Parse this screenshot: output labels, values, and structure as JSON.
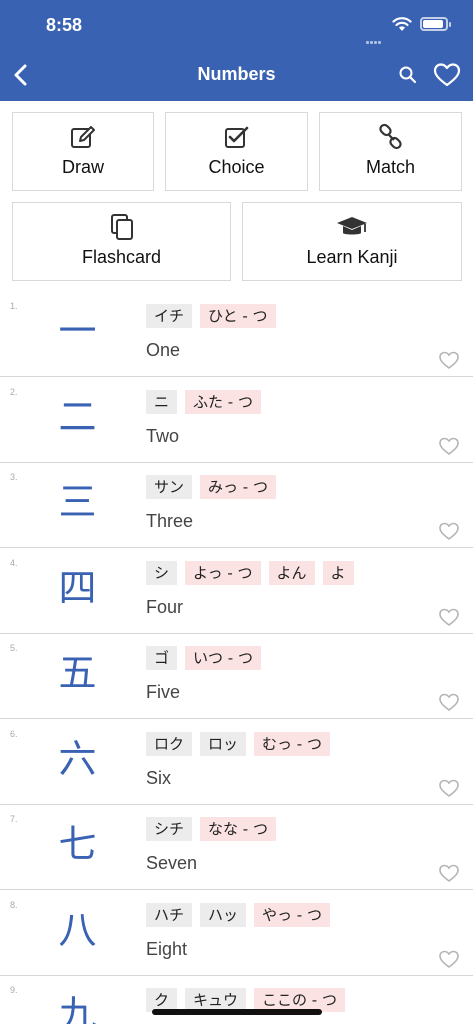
{
  "status_bar": {
    "time": "8:58"
  },
  "nav": {
    "title": "Numbers"
  },
  "modes": [
    {
      "label": "Draw",
      "icon": "pencil-square-icon"
    },
    {
      "label": "Choice",
      "icon": "checkbox-icon"
    },
    {
      "label": "Match",
      "icon": "link-icon"
    },
    {
      "label": "Flashcard",
      "icon": "cards-icon"
    },
    {
      "label": "Learn Kanji",
      "icon": "graduation-cap-icon"
    }
  ],
  "kanji_list": [
    {
      "num": "1.",
      "kanji": "一",
      "on": [
        "イチ"
      ],
      "kun": [
        "ひと - つ"
      ],
      "meaning": "One"
    },
    {
      "num": "2.",
      "kanji": "二",
      "on": [
        "ニ"
      ],
      "kun": [
        "ふた - つ"
      ],
      "meaning": "Two"
    },
    {
      "num": "3.",
      "kanji": "三",
      "on": [
        "サン"
      ],
      "kun": [
        "みっ - つ"
      ],
      "meaning": "Three"
    },
    {
      "num": "4.",
      "kanji": "四",
      "on": [
        "シ"
      ],
      "kun": [
        "よっ - つ",
        "よん",
        "よ"
      ],
      "meaning": "Four"
    },
    {
      "num": "5.",
      "kanji": "五",
      "on": [
        "ゴ"
      ],
      "kun": [
        "いつ - つ"
      ],
      "meaning": "Five"
    },
    {
      "num": "6.",
      "kanji": "六",
      "on": [
        "ロク",
        "ロッ"
      ],
      "kun": [
        "むっ - つ"
      ],
      "meaning": "Six"
    },
    {
      "num": "7.",
      "kanji": "七",
      "on": [
        "シチ"
      ],
      "kun": [
        "なな - つ"
      ],
      "meaning": "Seven"
    },
    {
      "num": "8.",
      "kanji": "八",
      "on": [
        "ハチ",
        "ハッ"
      ],
      "kun": [
        "やっ - つ"
      ],
      "meaning": "Eight"
    },
    {
      "num": "9.",
      "kanji": "九",
      "on": [
        "ク",
        "キュウ"
      ],
      "kun": [
        "ここの - つ"
      ],
      "meaning": ""
    }
  ],
  "colors": {
    "nav_bg": "#3a62b3",
    "kanji": "#3a62b3",
    "on_chip": "#ececec",
    "kun_chip": "#fbe3e3"
  }
}
